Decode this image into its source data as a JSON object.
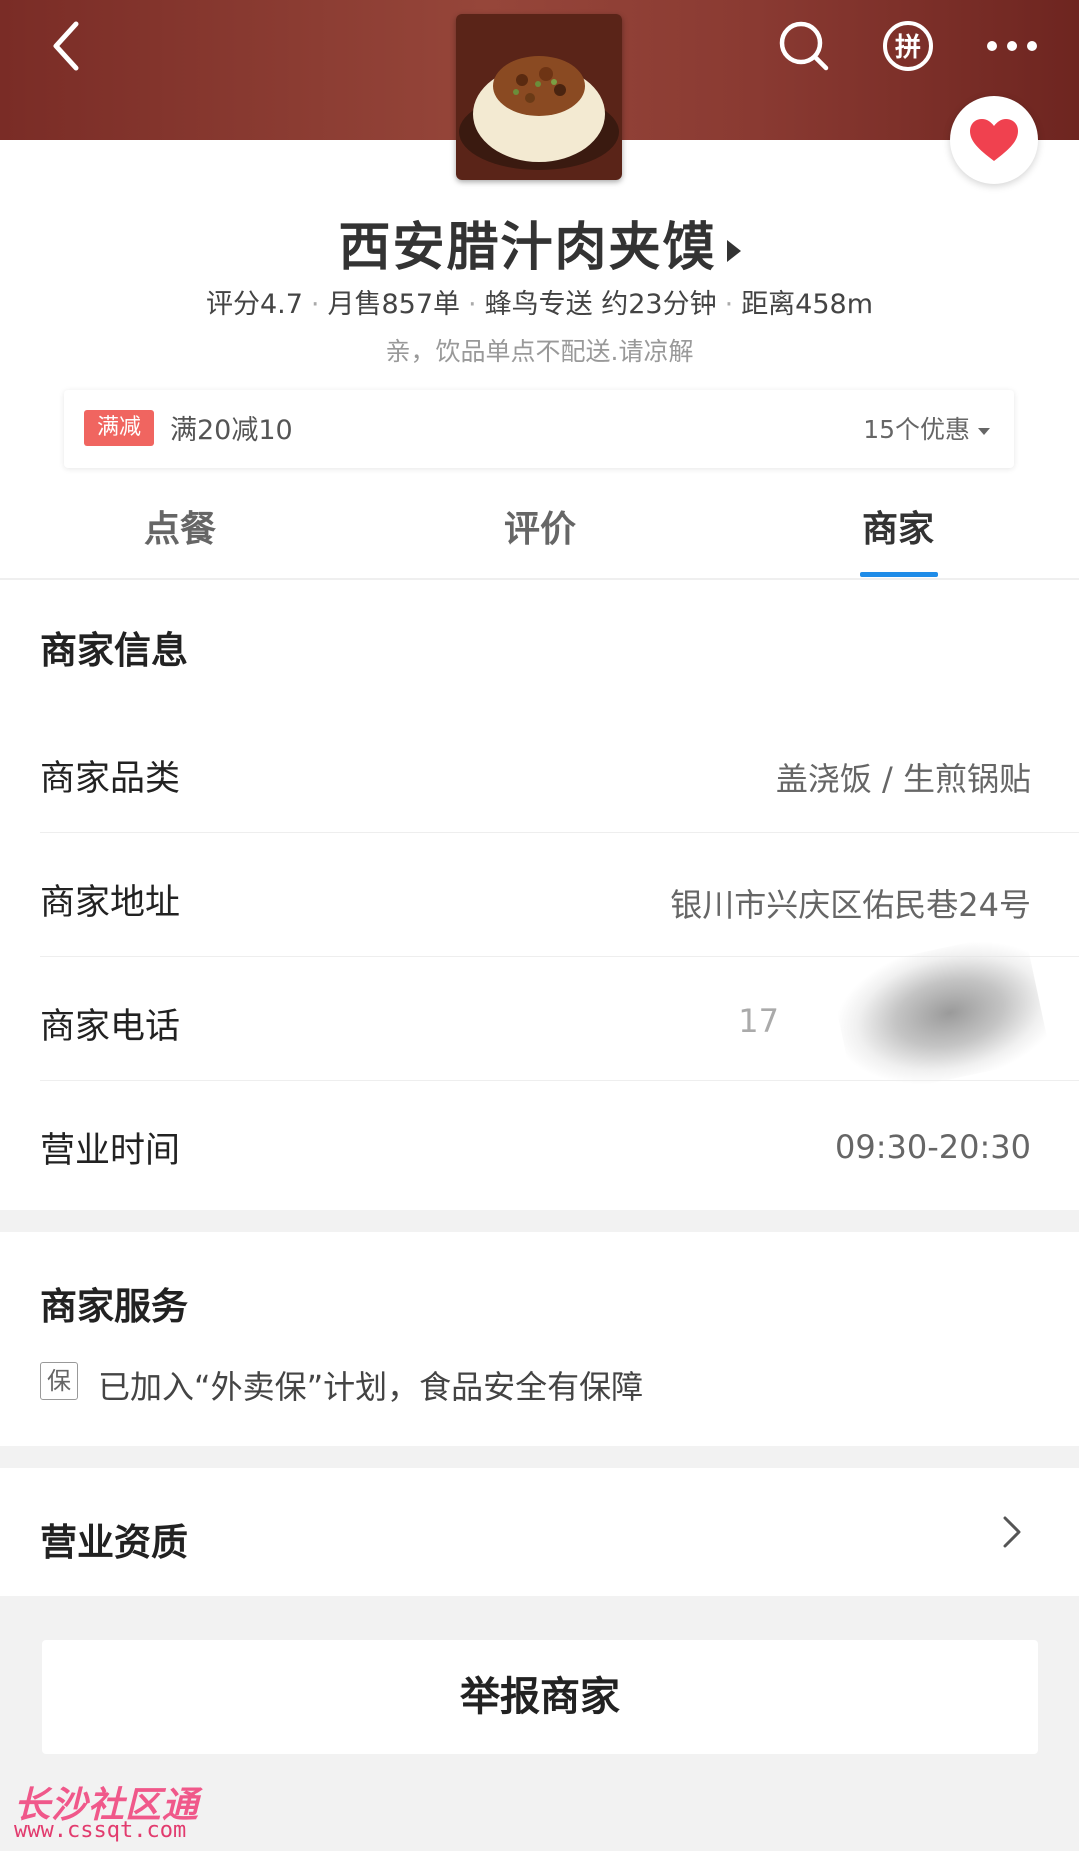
{
  "header": {
    "shop_name": "西安腊汁肉夹馍",
    "rating": "评分4.7",
    "monthly_sales": "月售857单",
    "delivery": "蜂鸟专送 约23分钟",
    "distance": "距离458m",
    "notice": "亲，饮品单点不配送.请凉解"
  },
  "promo": {
    "tag": "满减",
    "text": "满20减10",
    "more": "15个优惠"
  },
  "tabs": {
    "order": "点餐",
    "reviews": "评价",
    "merchant": "商家"
  },
  "merchant_info": {
    "title": "商家信息",
    "rows": [
      {
        "label": "商家品类",
        "value": "盖浇饭 / 生煎锅贴"
      },
      {
        "label": "商家地址",
        "value": "银川市兴庆区佑民巷24号"
      },
      {
        "label": "商家电话",
        "value": "17"
      },
      {
        "label": "营业时间",
        "value": "09:30-20:30"
      }
    ]
  },
  "service": {
    "title": "商家服务",
    "icon_char": "保",
    "text": "已加入“外卖保”计划，食品安全有保障"
  },
  "license": {
    "title": "营业资质"
  },
  "report_button": "举报商家",
  "watermark": {
    "logo": "长沙社区通",
    "url": "www.cssqt.com"
  },
  "colors": {
    "accent_blue": "#1f8ce8",
    "promo_red": "#f06560",
    "favorite_red": "#f0414f",
    "banner": "#8a3a32"
  }
}
